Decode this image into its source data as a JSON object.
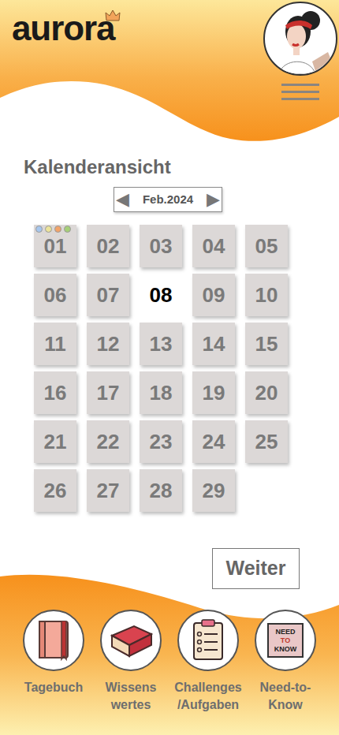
{
  "header": {
    "logo": "aurora"
  },
  "title": "Kalenderansicht",
  "month": {
    "label": "Feb.2024",
    "prev_icon": "◀",
    "next_icon": "▶"
  },
  "days": [
    {
      "day": "01",
      "selected": false,
      "dots": [
        {
          "color": "#a7c7ee"
        },
        {
          "color": "#ece39a"
        },
        {
          "color": "#f2a46a"
        },
        {
          "color": "#a6cf78"
        }
      ]
    },
    {
      "day": "02",
      "selected": false,
      "dots": []
    },
    {
      "day": "03",
      "selected": false,
      "dots": []
    },
    {
      "day": "04",
      "selected": false,
      "dots": []
    },
    {
      "day": "05",
      "selected": false,
      "dots": []
    },
    {
      "day": "06",
      "selected": false,
      "dots": []
    },
    {
      "day": "07",
      "selected": false,
      "dots": []
    },
    {
      "day": "08",
      "selected": true,
      "dots": []
    },
    {
      "day": "09",
      "selected": false,
      "dots": []
    },
    {
      "day": "10",
      "selected": false,
      "dots": []
    },
    {
      "day": "11",
      "selected": false,
      "dots": []
    },
    {
      "day": "12",
      "selected": false,
      "dots": []
    },
    {
      "day": "13",
      "selected": false,
      "dots": []
    },
    {
      "day": "14",
      "selected": false,
      "dots": []
    },
    {
      "day": "15",
      "selected": false,
      "dots": []
    },
    {
      "day": "16",
      "selected": false,
      "dots": []
    },
    {
      "day": "17",
      "selected": false,
      "dots": []
    },
    {
      "day": "18",
      "selected": false,
      "dots": []
    },
    {
      "day": "19",
      "selected": false,
      "dots": []
    },
    {
      "day": "20",
      "selected": false,
      "dots": []
    },
    {
      "day": "21",
      "selected": false,
      "dots": []
    },
    {
      "day": "22",
      "selected": false,
      "dots": []
    },
    {
      "day": "23",
      "selected": false,
      "dots": []
    },
    {
      "day": "24",
      "selected": false,
      "dots": []
    },
    {
      "day": "25",
      "selected": false,
      "dots": []
    },
    {
      "day": "26",
      "selected": false,
      "dots": []
    },
    {
      "day": "27",
      "selected": false,
      "dots": []
    },
    {
      "day": "28",
      "selected": false,
      "dots": []
    },
    {
      "day": "29",
      "selected": false,
      "dots": []
    }
  ],
  "next_button": {
    "label": "Weiter"
  },
  "nav": [
    {
      "kind": "diary",
      "lines": [
        "Tagebuch"
      ],
      "icon_text": []
    },
    {
      "kind": "book",
      "lines": [
        "Wissens",
        "wertes"
      ],
      "icon_text": []
    },
    {
      "kind": "clipboard",
      "lines": [
        "Challenges",
        "/Aufgaben"
      ],
      "icon_text": []
    },
    {
      "kind": "sign",
      "lines": [
        "Need-to-",
        "Know"
      ],
      "icon_text": [
        "NEED",
        "TO",
        "KNOW"
      ]
    }
  ]
}
